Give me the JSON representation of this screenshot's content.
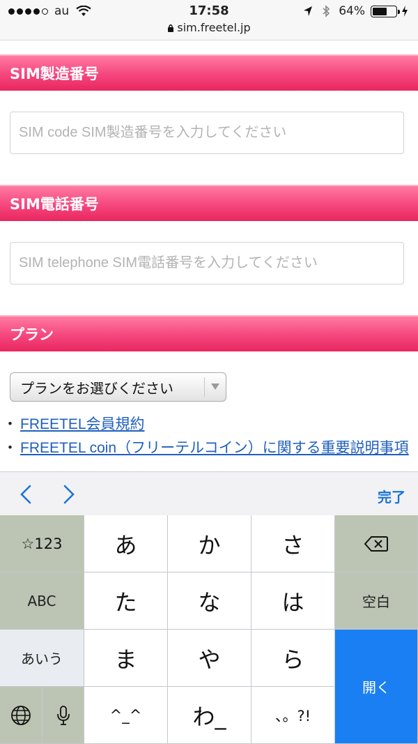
{
  "status_bar": {
    "carrier": "au",
    "time": "17:58",
    "battery_text": "64%",
    "battery_level": 0.64,
    "url": "sim.freetel.jp"
  },
  "sections": {
    "sim_code": {
      "title": "SIM製造番号",
      "placeholder": "SIM code SIM製造番号を入力してください"
    },
    "sim_phone": {
      "title": "SIM電話番号",
      "placeholder": "SIM telephone SIM電話番号を入力してください"
    },
    "plan": {
      "title": "プラン",
      "select_value": "プランをお選びください"
    }
  },
  "links": [
    {
      "bullet": "・",
      "text": "FREETEL会員規約"
    },
    {
      "bullet": "・",
      "text": "FREETEL coin（フリーテルコイン）に関する重要説明事項"
    }
  ],
  "accessory": {
    "done_label": "完了"
  },
  "keyboard": {
    "symbols": "☆123",
    "abc": "ABC",
    "aiu": "あいう",
    "a": "あ",
    "ka": "か",
    "sa": "さ",
    "ta": "た",
    "na": "な",
    "ha": "は",
    "ma": "ま",
    "ya": "や",
    "ra": "ら",
    "kaomoji": "^_^",
    "wa": "わ_",
    "punct": "、。?!",
    "space": "空白",
    "open": "開く"
  },
  "colors": {
    "header_pink": "#f64a80",
    "link_blue": "#1f5fbd",
    "key_blue": "#1b7ff4",
    "done_blue": "#1a73d9"
  }
}
